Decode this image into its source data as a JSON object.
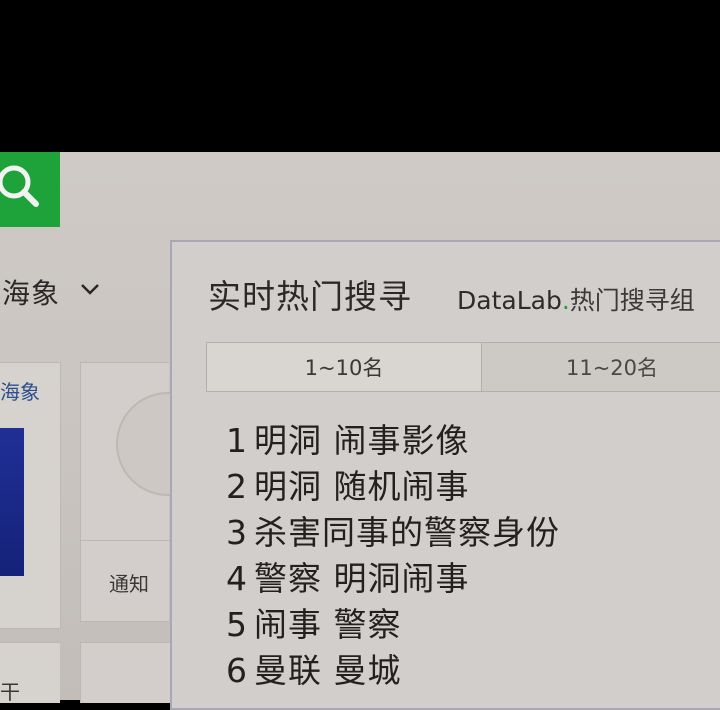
{
  "header": {
    "search_icon": "search-icon",
    "brand_color": "#1ea33a"
  },
  "user_menu": {
    "name": "海象",
    "chevron_icon": "chevron-down-icon"
  },
  "sidebar": {
    "card_label": "海象",
    "notice_label": "通知",
    "bottom_char": "干"
  },
  "trending": {
    "title": "实时热门搜寻",
    "datalab_brand": "DataLab",
    "datalab_dot": ".",
    "datalab_sub": "热门搜寻组",
    "tabs": [
      {
        "label": "1~10名",
        "active": true
      },
      {
        "label": "11~20名",
        "active": false
      }
    ],
    "items": [
      {
        "rank": "1",
        "text": "明洞 闹事影像"
      },
      {
        "rank": "2",
        "text": "明洞 随机闹事"
      },
      {
        "rank": "3",
        "text": "杀害同事的警察身份"
      },
      {
        "rank": "4",
        "text": "警察 明洞闹事"
      },
      {
        "rank": "5",
        "text": "闹事 警察"
      },
      {
        "rank": "6",
        "text": "曼联 曼城"
      }
    ]
  }
}
